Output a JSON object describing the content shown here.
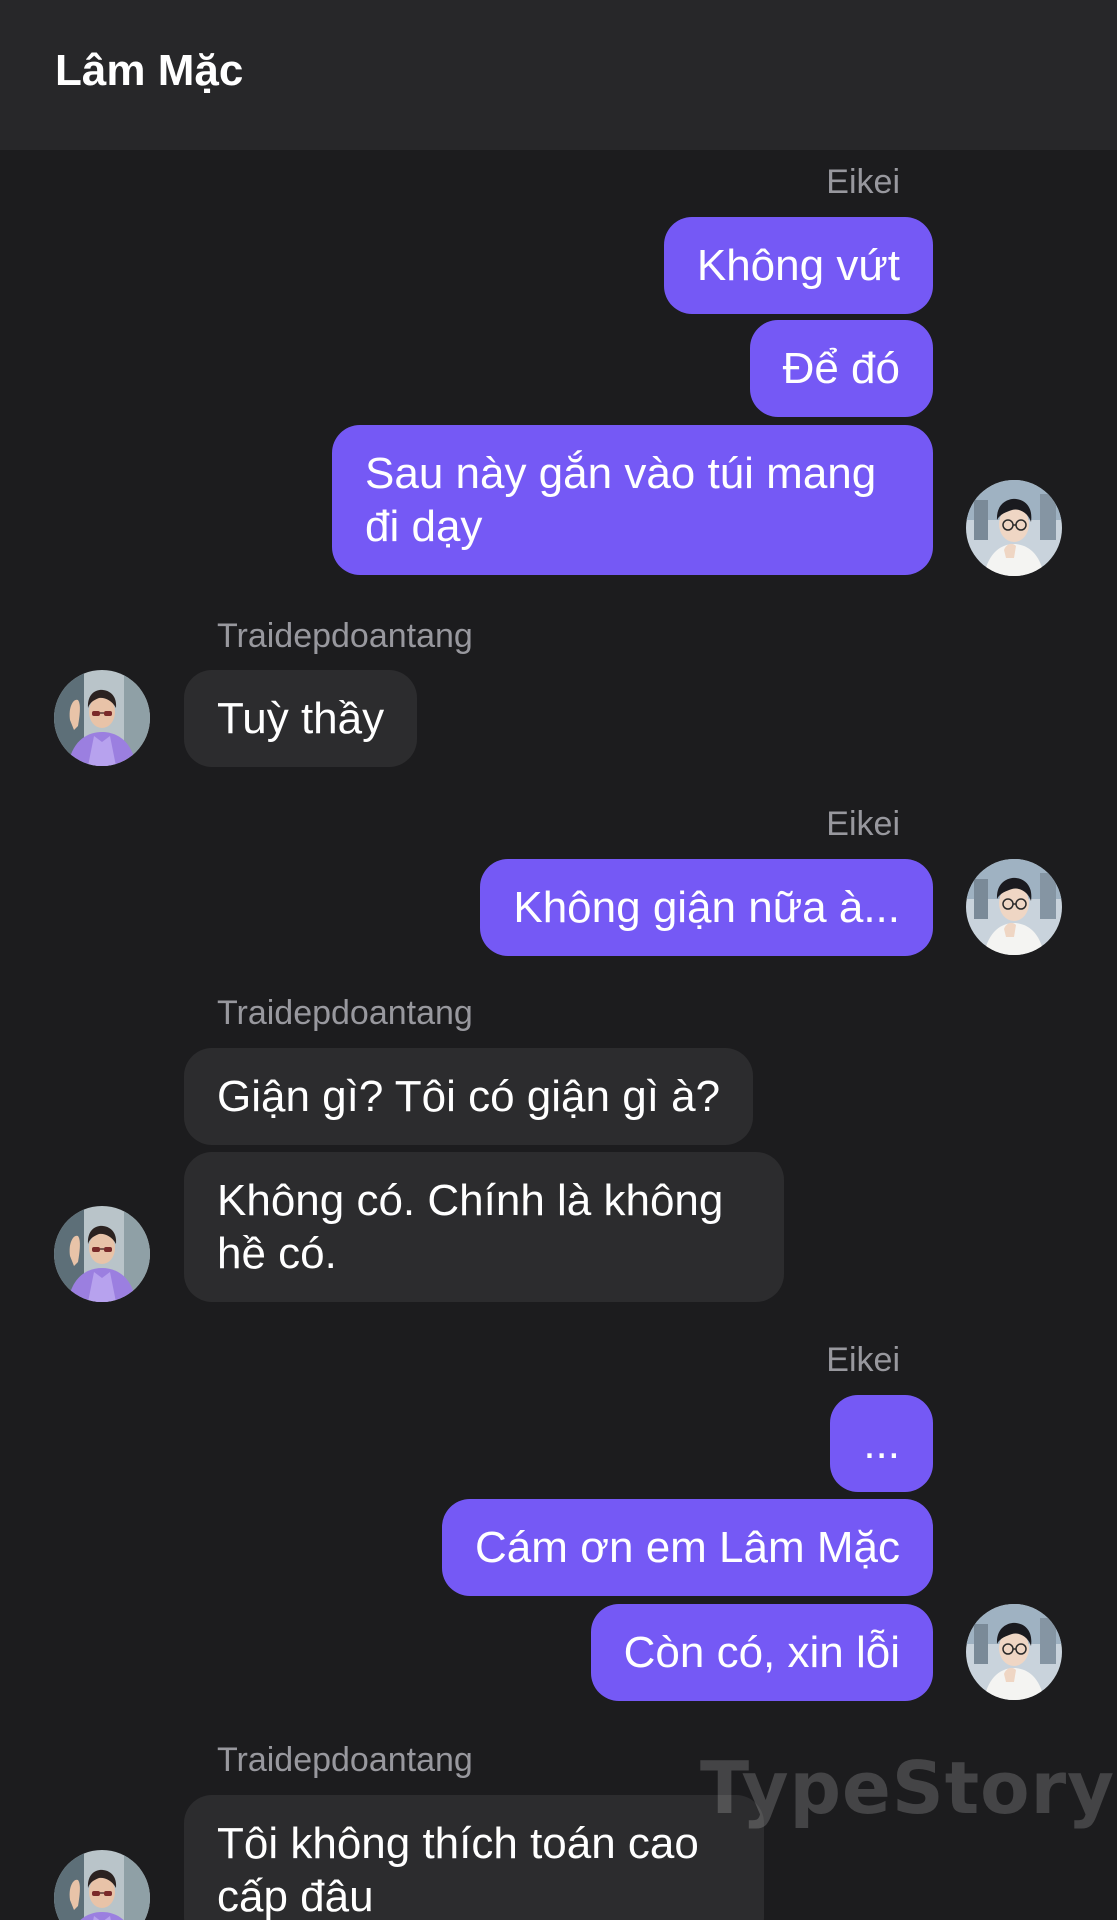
{
  "header": {
    "title": "Lâm Mặc"
  },
  "participants": {
    "me": "Eikei",
    "them": "Traidepdoantang"
  },
  "colors": {
    "background": "#1c1c1e",
    "header": "#272729",
    "outgoing_bubble": "#7559f5",
    "incoming_bubble": "#2c2c2e",
    "sender_name": "#98989e"
  },
  "messages": [
    {
      "sender": "Eikei",
      "direction": "outgoing",
      "texts": [
        "Không vứt",
        "Để đó",
        "Sau này gắn vào túi mang đi dạy"
      ]
    },
    {
      "sender": "Traidepdoantang",
      "direction": "incoming",
      "texts": [
        "Tuỳ thầy"
      ]
    },
    {
      "sender": "Eikei",
      "direction": "outgoing",
      "texts": [
        "Không giận nữa à..."
      ]
    },
    {
      "sender": "Traidepdoantang",
      "direction": "incoming",
      "texts": [
        "Giận gì? Tôi có giận gì à?",
        "Không có. Chính là không hề có."
      ]
    },
    {
      "sender": "Eikei",
      "direction": "outgoing",
      "texts": [
        "...",
        "Cám ơn em Lâm Mặc",
        "Còn có, xin lỗi"
      ]
    },
    {
      "sender": "Traidepdoantang",
      "direction": "incoming",
      "texts": [
        "Tôi không thích toán cao cấp đâu"
      ]
    }
  ],
  "watermark": "TypeStory"
}
